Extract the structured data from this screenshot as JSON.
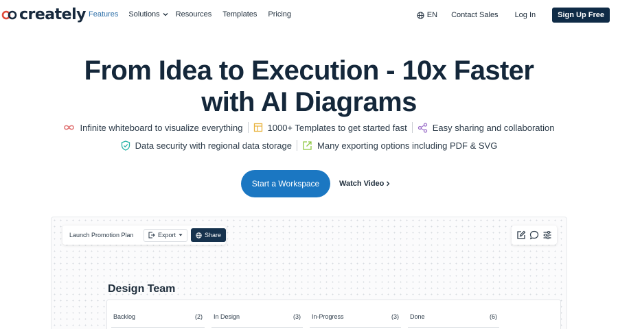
{
  "nav": {
    "logo_text": "creately",
    "links": [
      "Features",
      "Solutions",
      "Resources",
      "Templates",
      "Pricing"
    ],
    "lang": "EN",
    "contact_sales": "Contact Sales",
    "login": "Log In",
    "signup": "Sign Up Free"
  },
  "hero": {
    "title_line1": "From Idea to Execution - 10x Faster",
    "title_line2": "with AI Diagrams",
    "features": [
      "Infinite whiteboard to visualize everything",
      "1000+ Templates to get started fast",
      "Easy sharing and collaboration",
      "Data security with regional data storage",
      "Many exporting options including PDF & SVG"
    ],
    "cta_primary": "Start a Workspace",
    "cta_secondary": "Watch Video"
  },
  "board": {
    "doc_name": "Launch Promotion Plan",
    "export_label": "Export",
    "share_label": "Share",
    "team_title": "Design Team",
    "columns": [
      {
        "name": "Backlog",
        "count": "(2)"
      },
      {
        "name": "In Design",
        "count": "(3)"
      },
      {
        "name": "In-Progress",
        "count": "(3)"
      },
      {
        "name": "Done",
        "count": "(6)"
      }
    ]
  },
  "colors": {
    "primary": "#1b77c2",
    "dark": "#0f2b46",
    "accent_infinity": "#e07070",
    "accent_template": "#e8b13a",
    "accent_share": "#9b6fc9",
    "accent_security": "#24b3a5",
    "accent_export": "#8cc63f"
  }
}
